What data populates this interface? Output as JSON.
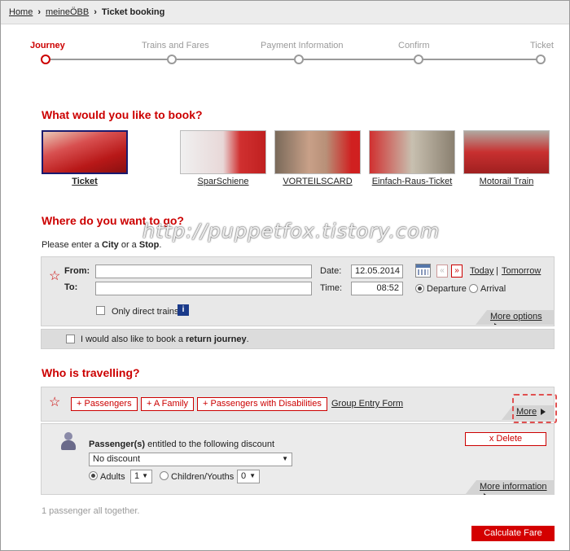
{
  "breadcrumb": {
    "home": "Home",
    "account": "meineÖBB",
    "current": "Ticket booking"
  },
  "steps": [
    "Journey",
    "Trains and Fares",
    "Payment Information",
    "Confirm",
    "Ticket"
  ],
  "book_section": {
    "title": "What would you like to book?",
    "tiles": [
      "Ticket",
      "SparSchiene",
      "VORTEILSCARD",
      "Einfach-Raus-Ticket",
      "Motorail Train"
    ]
  },
  "where_section": {
    "title": "Where do you want to go?",
    "hint_prefix": "Please enter a ",
    "hint_city": "City",
    "hint_or": " or a ",
    "hint_stop": "Stop",
    "hint_end": ".",
    "from_label": "From:",
    "to_label": "To:",
    "from_value": "",
    "to_value": "",
    "date_label": "Date:",
    "date_value": "12.05.2014",
    "time_label": "Time:",
    "time_value": "08:52",
    "prev": "«",
    "next": "»",
    "today": "Today",
    "sep": "|",
    "tomorrow": "Tomorrow",
    "departure": "Departure",
    "arrival": "Arrival",
    "direct_only": "Only direct trains",
    "info_icon_text": "i",
    "more_options": "More options",
    "return_prefix": "I would also like to book a ",
    "return_bold": "return journey",
    "return_end": "."
  },
  "watermark": "http://puppetfox.tistory.com",
  "who_section": {
    "title": "Who is travelling?",
    "add_passengers": "+ Passengers",
    "add_family": "+ A Family",
    "add_disabilities": "+ Passengers with Disabilities",
    "group_entry": "Group Entry Form",
    "more": "More",
    "passenger_bold": "Passenger(s)",
    "passenger_rest": " entitled to the following discount",
    "delete": "x Delete",
    "discount_value": "No discount",
    "adults_label": "Adults",
    "adults_value": "1",
    "children_label": "Children/Youths",
    "children_value": "0",
    "more_information": "More information"
  },
  "summary": "1 passenger all together.",
  "calculate": "Calculate Fare",
  "colors": {
    "accent": "#cc0000",
    "panel": "#e8e8e8"
  }
}
